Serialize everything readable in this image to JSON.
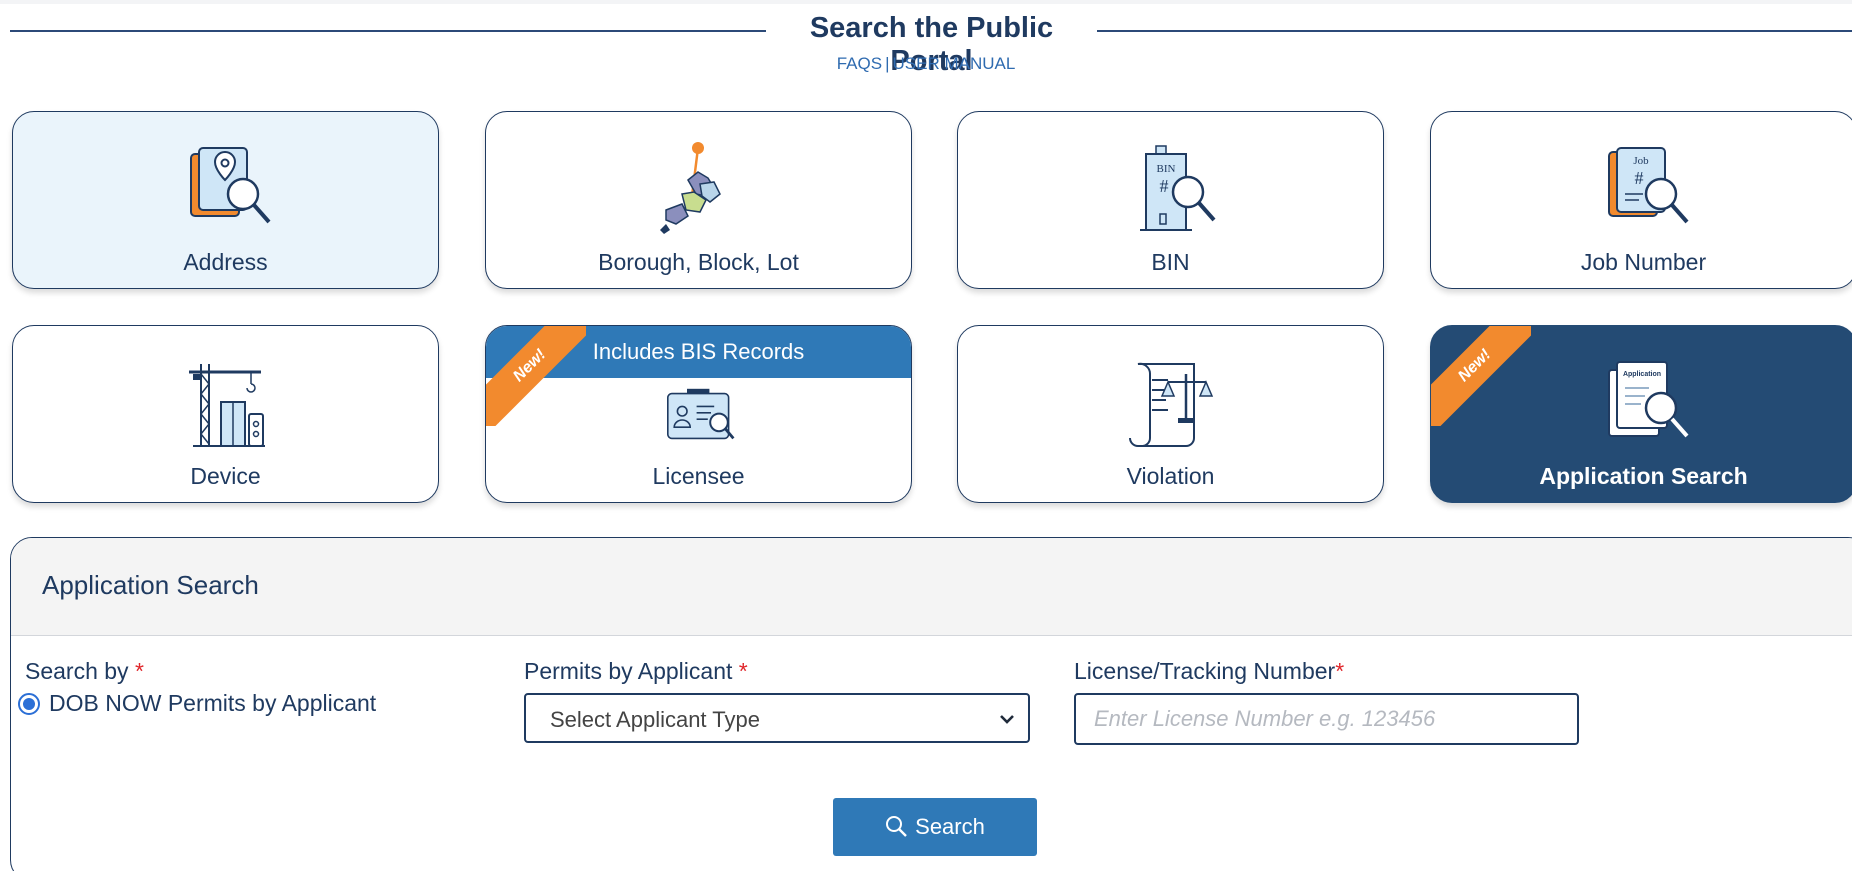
{
  "header": {
    "title": "Search the Public Portal",
    "faqs_link": "FAQS",
    "separator": "|",
    "manual_link": "USER MANUAL"
  },
  "tiles": [
    {
      "label": "Address",
      "icon": "address-search-icon",
      "state": "highlighted"
    },
    {
      "label": "Borough, Block, Lot",
      "icon": "borough-map-icon"
    },
    {
      "label": "BIN",
      "icon": "bin-building-icon",
      "icon_text": "BIN",
      "icon_hash": "#"
    },
    {
      "label": "Job Number",
      "icon": "job-number-icon",
      "icon_text": "Job",
      "icon_hash": "#"
    },
    {
      "label": "Device",
      "icon": "crane-device-icon"
    },
    {
      "label": "Licensee",
      "icon": "license-card-icon",
      "badge": "New!",
      "banner": "Includes BIS Records"
    },
    {
      "label": "Violation",
      "icon": "violation-scales-icon"
    },
    {
      "label": "Application Search",
      "icon": "application-search-icon",
      "badge": "New!",
      "icon_text": "Application",
      "state": "selected"
    }
  ],
  "form": {
    "title": "Application Search",
    "search_by_label": "Search by",
    "required_mark": "*",
    "radio_option": "DOB NOW Permits by Applicant",
    "permits_label": "Permits by Applicant",
    "select_value": "Select Applicant Type",
    "license_label": "License/Tracking Number",
    "license_placeholder": "Enter License Number e.g. 123456",
    "search_button": "Search"
  },
  "colors": {
    "navy": "#1f3a60",
    "selected_tile": "#244b74",
    "highlight_tile": "#eaf4fb",
    "banner_blue": "#2f79b7",
    "ribbon_orange": "#f28a2e",
    "required_red": "#e0262b"
  }
}
